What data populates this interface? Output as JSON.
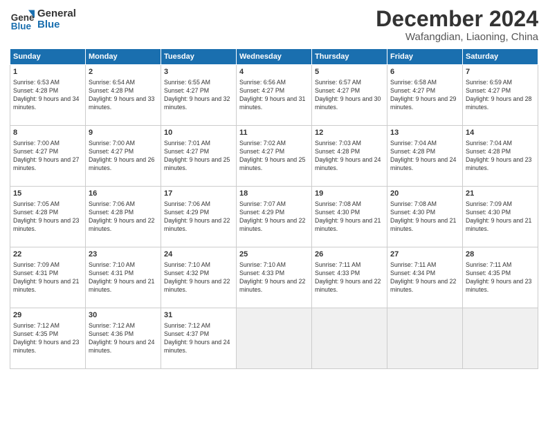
{
  "header": {
    "logo_line1": "General",
    "logo_line2": "Blue",
    "month_title": "December 2024",
    "location": "Wafangdian, Liaoning, China"
  },
  "days_of_week": [
    "Sunday",
    "Monday",
    "Tuesday",
    "Wednesday",
    "Thursday",
    "Friday",
    "Saturday"
  ],
  "weeks": [
    [
      {
        "day": "1",
        "sunrise": "6:53 AM",
        "sunset": "4:28 PM",
        "daylight": "9 hours and 34 minutes."
      },
      {
        "day": "2",
        "sunrise": "6:54 AM",
        "sunset": "4:28 PM",
        "daylight": "9 hours and 33 minutes."
      },
      {
        "day": "3",
        "sunrise": "6:55 AM",
        "sunset": "4:27 PM",
        "daylight": "9 hours and 32 minutes."
      },
      {
        "day": "4",
        "sunrise": "6:56 AM",
        "sunset": "4:27 PM",
        "daylight": "9 hours and 31 minutes."
      },
      {
        "day": "5",
        "sunrise": "6:57 AM",
        "sunset": "4:27 PM",
        "daylight": "9 hours and 30 minutes."
      },
      {
        "day": "6",
        "sunrise": "6:58 AM",
        "sunset": "4:27 PM",
        "daylight": "9 hours and 29 minutes."
      },
      {
        "day": "7",
        "sunrise": "6:59 AM",
        "sunset": "4:27 PM",
        "daylight": "9 hours and 28 minutes."
      }
    ],
    [
      {
        "day": "8",
        "sunrise": "7:00 AM",
        "sunset": "4:27 PM",
        "daylight": "9 hours and 27 minutes."
      },
      {
        "day": "9",
        "sunrise": "7:00 AM",
        "sunset": "4:27 PM",
        "daylight": "9 hours and 26 minutes."
      },
      {
        "day": "10",
        "sunrise": "7:01 AM",
        "sunset": "4:27 PM",
        "daylight": "9 hours and 25 minutes."
      },
      {
        "day": "11",
        "sunrise": "7:02 AM",
        "sunset": "4:27 PM",
        "daylight": "9 hours and 25 minutes."
      },
      {
        "day": "12",
        "sunrise": "7:03 AM",
        "sunset": "4:28 PM",
        "daylight": "9 hours and 24 minutes."
      },
      {
        "day": "13",
        "sunrise": "7:04 AM",
        "sunset": "4:28 PM",
        "daylight": "9 hours and 24 minutes."
      },
      {
        "day": "14",
        "sunrise": "7:04 AM",
        "sunset": "4:28 PM",
        "daylight": "9 hours and 23 minutes."
      }
    ],
    [
      {
        "day": "15",
        "sunrise": "7:05 AM",
        "sunset": "4:28 PM",
        "daylight": "9 hours and 23 minutes."
      },
      {
        "day": "16",
        "sunrise": "7:06 AM",
        "sunset": "4:28 PM",
        "daylight": "9 hours and 22 minutes."
      },
      {
        "day": "17",
        "sunrise": "7:06 AM",
        "sunset": "4:29 PM",
        "daylight": "9 hours and 22 minutes."
      },
      {
        "day": "18",
        "sunrise": "7:07 AM",
        "sunset": "4:29 PM",
        "daylight": "9 hours and 22 minutes."
      },
      {
        "day": "19",
        "sunrise": "7:08 AM",
        "sunset": "4:30 PM",
        "daylight": "9 hours and 21 minutes."
      },
      {
        "day": "20",
        "sunrise": "7:08 AM",
        "sunset": "4:30 PM",
        "daylight": "9 hours and 21 minutes."
      },
      {
        "day": "21",
        "sunrise": "7:09 AM",
        "sunset": "4:30 PM",
        "daylight": "9 hours and 21 minutes."
      }
    ],
    [
      {
        "day": "22",
        "sunrise": "7:09 AM",
        "sunset": "4:31 PM",
        "daylight": "9 hours and 21 minutes."
      },
      {
        "day": "23",
        "sunrise": "7:10 AM",
        "sunset": "4:31 PM",
        "daylight": "9 hours and 21 minutes."
      },
      {
        "day": "24",
        "sunrise": "7:10 AM",
        "sunset": "4:32 PM",
        "daylight": "9 hours and 22 minutes."
      },
      {
        "day": "25",
        "sunrise": "7:10 AM",
        "sunset": "4:33 PM",
        "daylight": "9 hours and 22 minutes."
      },
      {
        "day": "26",
        "sunrise": "7:11 AM",
        "sunset": "4:33 PM",
        "daylight": "9 hours and 22 minutes."
      },
      {
        "day": "27",
        "sunrise": "7:11 AM",
        "sunset": "4:34 PM",
        "daylight": "9 hours and 22 minutes."
      },
      {
        "day": "28",
        "sunrise": "7:11 AM",
        "sunset": "4:35 PM",
        "daylight": "9 hours and 23 minutes."
      }
    ],
    [
      {
        "day": "29",
        "sunrise": "7:12 AM",
        "sunset": "4:35 PM",
        "daylight": "9 hours and 23 minutes."
      },
      {
        "day": "30",
        "sunrise": "7:12 AM",
        "sunset": "4:36 PM",
        "daylight": "9 hours and 24 minutes."
      },
      {
        "day": "31",
        "sunrise": "7:12 AM",
        "sunset": "4:37 PM",
        "daylight": "9 hours and 24 minutes."
      },
      null,
      null,
      null,
      null
    ]
  ],
  "labels": {
    "sunrise": "Sunrise:",
    "sunset": "Sunset:",
    "daylight": "Daylight:"
  }
}
